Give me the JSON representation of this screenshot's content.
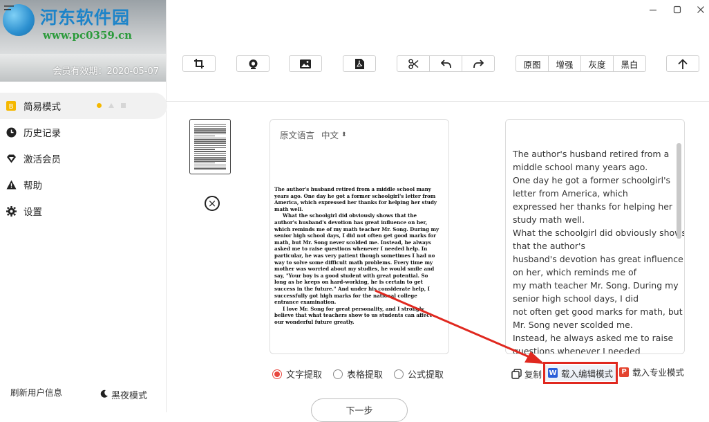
{
  "brand": {
    "logo_text": "河东软件园",
    "logo_url": "www.pc0359.cn",
    "member_validity": "会员有效期：2020-05-07"
  },
  "sidebar": {
    "items": [
      {
        "label": "简易模式",
        "icon": "simple-mode-icon",
        "active": true
      },
      {
        "label": "历史记录",
        "icon": "clock-icon"
      },
      {
        "label": "激活会员",
        "icon": "diamond-icon"
      },
      {
        "label": "帮助",
        "icon": "warning-icon"
      },
      {
        "label": "设置",
        "icon": "gear-icon"
      }
    ],
    "refresh_label": "刷新用户信息",
    "night_mode_label": "黑夜模式"
  },
  "toolbar": {
    "filters": [
      "原图",
      "增强",
      "灰度",
      "黑白"
    ]
  },
  "source": {
    "language_label": "原文语言",
    "language_value": "中文",
    "doc_paragraphs": [
      "The author's husband retired from a middle school many years ago. One day he got a former schoolgirl's letter from America, which expressed her thanks for helping her study math well.",
      "What the schoolgirl did obviously shows that the author's husband's devotion has great influence on her, which reminds me of my math teacher Mr. Song. During my senior high school days, I did not often get good marks for math, but Mr. Song never scolded me. Instead, he always asked me to raise questions whenever I needed help. In particular, he was very patient though sometimes I had no way to solve some difficult math problems. Every time my mother was worried about my studies, he would smile and say, \"Your boy is a good student with great potential. So long as he keeps on hard-working, he is certain to get success in the future.\" And under his considerate help, I successfully got high marks for the national college entrance examination.",
      "I love Mr. Song for great personality, and I strongly believe that what teachers show to us students can affect our wonderful future greatly."
    ]
  },
  "result": {
    "lines": [
      "The author's husband retired from a",
      "middle school many years ago.",
      "One day he got a former schoolgirl's",
      "letter from America, which",
      "expressed her thanks for helping her",
      "study math well.",
      "What the schoolgirl did obviously shows",
      "that the author's",
      "husband's devotion has great influence",
      "on her, which reminds me of",
      "my math teacher Mr. Song. During my",
      "senior high school days, I did",
      "not often get good marks for math, but",
      "Mr. Song never scolded me.",
      "Instead, he always asked me to raise",
      "questions whenever I needed"
    ]
  },
  "extract_modes": [
    {
      "label": "文字提取",
      "selected": true
    },
    {
      "label": "表格提取",
      "selected": false
    },
    {
      "label": "公式提取",
      "selected": false
    }
  ],
  "actions": {
    "copy_label": "复制",
    "load_edit_label": "载入编辑模式",
    "load_edit_badge": "W",
    "load_pro_label": "载入专业模式",
    "load_pro_badge": "P"
  },
  "next_label": "下一步",
  "colors": {
    "accent_red": "#e8473e",
    "highlight_box": "#e0281f",
    "word_blue": "#2b5fd9",
    "pdf_red": "#e4442f",
    "dot_yellow": "#f5b800"
  }
}
